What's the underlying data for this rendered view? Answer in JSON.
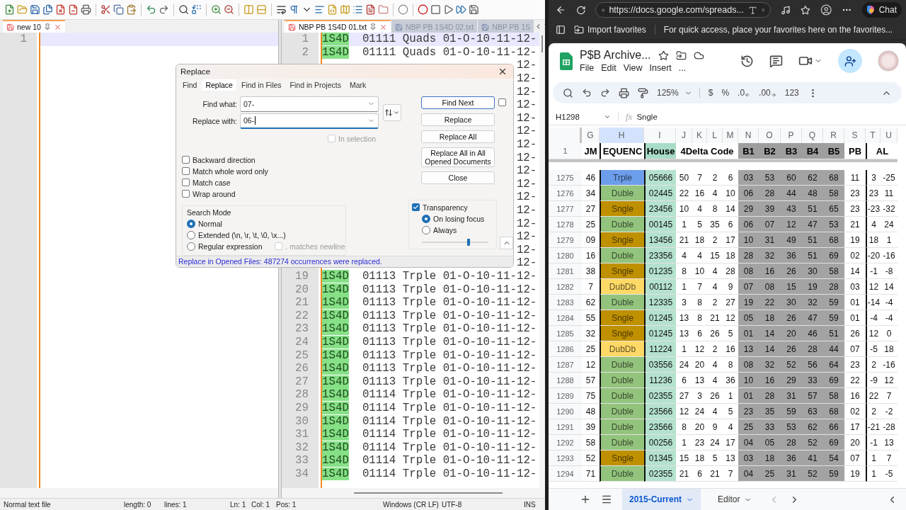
{
  "notepad": {
    "left_pane": {
      "tabs": [
        {
          "label": "new 10",
          "selected": true
        }
      ],
      "lines": [
        {
          "kind": "empty",
          "number": "1",
          "current": true
        }
      ]
    },
    "right_pane": {
      "tabs": [
        {
          "label": "NBP PB 1S4D 01.txt",
          "selected": true
        },
        {
          "label": "NBP PB 1S4D 02.txt",
          "selected": false
        },
        {
          "label": "NBP PB 1S",
          "selected": false
        }
      ],
      "lines": [
        {
          "kind": "full",
          "number": "1",
          "tag": "1S4D",
          "text": "01111 Quads 01-O-10-11-12-",
          "current": true
        },
        {
          "kind": "full",
          "number": "2",
          "tag": "1S4D",
          "text": "01111 Quads 01-O-10-11-12-",
          "current": false
        },
        {
          "kind": "tail",
          "text": "12-"
        },
        {
          "kind": "tail",
          "text": "12-"
        },
        {
          "kind": "tail",
          "text": "12-"
        },
        {
          "kind": "tail",
          "text": "12-"
        },
        {
          "kind": "tail",
          "text": "12-"
        },
        {
          "kind": "tail",
          "text": "12-"
        },
        {
          "kind": "tail",
          "text": "12-"
        },
        {
          "kind": "tail",
          "text": "12-"
        },
        {
          "kind": "tail",
          "text": "12-"
        },
        {
          "kind": "tail",
          "text": "12-"
        },
        {
          "kind": "tail",
          "text": "12-"
        },
        {
          "kind": "tail",
          "text": "12-"
        },
        {
          "kind": "tail",
          "text": "12-"
        },
        {
          "kind": "tail",
          "text": "12-"
        },
        {
          "kind": "tail",
          "text": "12-"
        },
        {
          "kind": "tail",
          "text": "12-"
        },
        {
          "kind": "full",
          "number": "19",
          "tag": "1S4D",
          "text": "01113 Trple 01-O-10-11-12-",
          "current": false
        },
        {
          "kind": "full",
          "number": "20",
          "tag": "1S4D",
          "text": "01113 Trple 01-O-10-11-12-",
          "current": false
        },
        {
          "kind": "full",
          "number": "21",
          "tag": "1S4D",
          "text": "01113 Trple 01-O-10-11-12-",
          "current": false
        },
        {
          "kind": "full",
          "number": "22",
          "tag": "1S4D",
          "text": "01113 Trple 01-O-10-11-12-",
          "current": false
        },
        {
          "kind": "full",
          "number": "23",
          "tag": "1S4D",
          "text": "01113 Trple 01-O-10-11-12-",
          "current": false
        },
        {
          "kind": "full",
          "number": "24",
          "tag": "1S4D",
          "text": "01113 Trple 01-O-10-11-12-",
          "current": false
        },
        {
          "kind": "full",
          "number": "25",
          "tag": "1S4D",
          "text": "01113 Trple 01-O-10-11-12-",
          "current": false
        },
        {
          "kind": "full",
          "number": "26",
          "tag": "1S4D",
          "text": "01113 Trple 01-O-10-11-12-",
          "current": false
        },
        {
          "kind": "full",
          "number": "27",
          "tag": "1S4D",
          "text": "01113 Trple 01-O-10-11-12-",
          "current": false
        },
        {
          "kind": "full",
          "number": "28",
          "tag": "1S4D",
          "text": "01114 Trple 01-O-10-11-12-",
          "current": false
        },
        {
          "kind": "full",
          "number": "29",
          "tag": "1S4D",
          "text": "01114 Trple 01-O-10-11-12-",
          "current": false
        },
        {
          "kind": "full",
          "number": "30",
          "tag": "1S4D",
          "text": "01114 Trple 01-O-10-11-12-",
          "current": false
        },
        {
          "kind": "full",
          "number": "31",
          "tag": "1S4D",
          "text": "01114 Trple 01-O-10-11-12-",
          "current": false
        },
        {
          "kind": "full",
          "number": "32",
          "tag": "1S4D",
          "text": "01114 Trple 01-O-10-11-12-",
          "current": false
        },
        {
          "kind": "full",
          "number": "33",
          "tag": "1S4D",
          "text": "01114 Trple 01-O-10-11-12-",
          "current": false
        },
        {
          "kind": "full",
          "number": "34",
          "tag": "1S4D",
          "text": "01114 Trple 01-O-10-11-12-",
          "current": false
        }
      ]
    },
    "status_bar": [
      "Normal text file",
      "length: 0",
      "lines: 1",
      "Ln: 1",
      "Col: 1",
      "Pos: 1",
      "Windows (CR LF)",
      "UTF-8",
      "INS"
    ]
  },
  "replace_dialog": {
    "title": "Replace",
    "tabs": [
      {
        "label": "Find",
        "selected": false
      },
      {
        "label": "Replace",
        "selected": true
      },
      {
        "label": "Find in Files",
        "selected": false
      },
      {
        "label": "Find in Projects",
        "selected": false
      },
      {
        "label": "Mark",
        "selected": false
      }
    ],
    "fields": [
      {
        "label": "Find what:",
        "value": "07-",
        "focused": false
      },
      {
        "label": "Replace with:",
        "value": "06-",
        "focused": true
      }
    ],
    "in_selection": {
      "label": "In selection",
      "checked": false,
      "disabled": true
    },
    "options": [
      {
        "label": "Backward direction",
        "checked": false
      },
      {
        "label": "Match whole word only",
        "checked": false
      },
      {
        "label": "Match case",
        "checked": false
      },
      {
        "label": "Wrap around",
        "checked": false
      }
    ],
    "search_mode": {
      "title": "Search Mode",
      "modes": [
        {
          "label": "Normal",
          "selected": true
        },
        {
          "label": "Extended (\\n, \\r, \\t, \\0, \\x...)",
          "selected": false
        },
        {
          "label": "Regular expression",
          "selected": false
        }
      ],
      "dot_newline": {
        "label": ". matches newline",
        "checked": false,
        "disabled": true
      }
    },
    "buttons": [
      {
        "label": "Find Next",
        "default": true
      },
      {
        "label": "Replace",
        "default": false
      },
      {
        "label": "Replace All",
        "default": false
      },
      {
        "label": "Replace All in All Opened Documents",
        "default": false
      },
      {
        "label": "Close",
        "default": false
      }
    ],
    "find_next_option": {
      "checked": false
    },
    "transparency": {
      "label": "Transparency",
      "checked": true,
      "modes": [
        {
          "label": "On losing focus",
          "selected": true
        },
        {
          "label": "Always",
          "selected": false
        }
      ],
      "level": 0.7
    },
    "status": "Replace in Opened Files: 487274 occurrences were replaced."
  },
  "browser": {
    "address": "https://docs.google.com/spreads...",
    "chat_button": "Chat",
    "favorites_bar": {
      "import": "Import favorites",
      "hint": "For quick access, place your favorites here on the favorites..."
    },
    "sheet": {
      "title": "P$B Archive...",
      "menu": [
        "File",
        "Edit",
        "View",
        "Insert",
        "..."
      ],
      "toolbar": {
        "zoom": "125%",
        "formats": [
          {
            "label": "$",
            "kind": "text"
          },
          {
            "label": "%",
            "kind": "text"
          },
          {
            "label": ".0",
            "kind": "decrease"
          },
          {
            "label": ".00",
            "kind": "increase"
          },
          {
            "label": "123",
            "kind": "text"
          }
        ]
      },
      "name_box": "H1298",
      "fx_label": "fx",
      "formula": "Sngle",
      "columns": [
        {
          "label": "G",
          "selected": false
        },
        {
          "label": "H",
          "selected": true
        },
        {
          "label": "I",
          "selected": false
        },
        {
          "label": "J",
          "selected": false
        },
        {
          "label": "K",
          "selected": false
        },
        {
          "label": "L",
          "selected": false
        },
        {
          "label": "M",
          "selected": false
        },
        {
          "label": "N",
          "selected": false
        },
        {
          "label": "O",
          "selected": false
        },
        {
          "label": "P",
          "selected": false
        },
        {
          "label": "Q",
          "selected": false
        },
        {
          "label": "R",
          "selected": false
        },
        {
          "label": "S",
          "selected": false
        },
        {
          "label": "T",
          "selected": false
        },
        {
          "label": "U",
          "selected": false
        }
      ],
      "header_row": {
        "number": "1",
        "cells": [
          "JM",
          "EQUENC",
          "House",
          "4Delta Code",
          "B1",
          "B2",
          "B3",
          "B4",
          "B5",
          "PB",
          "AL"
        ]
      },
      "rows": [
        {
          "number": "1275",
          "color": "#6d9eeb",
          "cells": [
            "46",
            "Trple",
            "05666",
            "50",
            "7",
            "2",
            "6",
            "03",
            "53",
            "60",
            "62",
            "68",
            "11",
            "3",
            "-25"
          ]
        },
        {
          "number": "1276",
          "color": "#93c47d",
          "cells": [
            "34",
            "Duble",
            "02445",
            "22",
            "16",
            "4",
            "10",
            "06",
            "28",
            "44",
            "48",
            "58",
            "23",
            "23",
            "11"
          ]
        },
        {
          "number": "1277",
          "color": "#bf9000",
          "cells": [
            "27",
            "Sngle",
            "23456",
            "10",
            "4",
            "8",
            "14",
            "29",
            "39",
            "43",
            "51",
            "65",
            "23",
            "-23",
            "-32"
          ]
        },
        {
          "number": "1278",
          "color": "#93c47d",
          "cells": [
            "25",
            "Duble",
            "00145",
            "1",
            "5",
            "35",
            "6",
            "06",
            "07",
            "12",
            "47",
            "53",
            "21",
            "4",
            "24"
          ]
        },
        {
          "number": "1279",
          "color": "#bf9000",
          "cells": [
            "09",
            "Sngle",
            "13456",
            "21",
            "18",
            "2",
            "17",
            "10",
            "31",
            "49",
            "51",
            "68",
            "19",
            "18",
            "1"
          ]
        },
        {
          "number": "1280",
          "color": "#93c47d",
          "cells": [
            "16",
            "Duble",
            "23356",
            "4",
            "4",
            "15",
            "18",
            "28",
            "32",
            "36",
            "51",
            "69",
            "02",
            "-20",
            "-16"
          ]
        },
        {
          "number": "1281",
          "color": "#bf9000",
          "cells": [
            "38",
            "Sngle",
            "01235",
            "8",
            "10",
            "4",
            "28",
            "08",
            "16",
            "26",
            "30",
            "58",
            "14",
            "-1",
            "-8"
          ]
        },
        {
          "number": "1282",
          "color": "#ffd966",
          "cells": [
            "7",
            "DubDb",
            "00112",
            "1",
            "7",
            "4",
            "9",
            "07",
            "08",
            "15",
            "19",
            "28",
            "03",
            "12",
            "14"
          ]
        },
        {
          "number": "1283",
          "color": "#93c47d",
          "cells": [
            "62",
            "Duble",
            "12335",
            "3",
            "8",
            "2",
            "27",
            "19",
            "22",
            "30",
            "32",
            "59",
            "01",
            "-14",
            "-4"
          ]
        },
        {
          "number": "1284",
          "color": "#bf9000",
          "cells": [
            "55",
            "Sngle",
            "01245",
            "13",
            "8",
            "21",
            "12",
            "05",
            "18",
            "26",
            "47",
            "59",
            "01",
            "-4",
            "-4"
          ]
        },
        {
          "number": "1285",
          "color": "#bf9000",
          "cells": [
            "32",
            "Sngle",
            "01245",
            "13",
            "6",
            "26",
            "5",
            "01",
            "14",
            "20",
            "46",
            "51",
            "26",
            "12",
            "0"
          ]
        },
        {
          "number": "1286",
          "color": "#ffd966",
          "cells": [
            "25",
            "DubDb",
            "11224",
            "1",
            "12",
            "2",
            "16",
            "13",
            "14",
            "26",
            "28",
            "44",
            "07",
            "-5",
            "18"
          ]
        },
        {
          "number": "1287",
          "color": "#93c47d",
          "cells": [
            "12",
            "Duble",
            "03556",
            "24",
            "20",
            "4",
            "8",
            "08",
            "32",
            "52",
            "56",
            "64",
            "23",
            "2",
            "-16"
          ]
        },
        {
          "number": "1288",
          "color": "#93c47d",
          "cells": [
            "57",
            "Duble",
            "11236",
            "6",
            "13",
            "4",
            "36",
            "10",
            "16",
            "29",
            "33",
            "69",
            "22",
            "-9",
            "12"
          ]
        },
        {
          "number": "1289",
          "color": "#93c47d",
          "cells": [
            "75",
            "Duble",
            "02355",
            "27",
            "3",
            "26",
            "1",
            "01",
            "28",
            "31",
            "57",
            "58",
            "16",
            "22",
            "7"
          ]
        },
        {
          "number": "1290",
          "color": "#93c47d",
          "cells": [
            "48",
            "Duble",
            "23566",
            "12",
            "24",
            "4",
            "5",
            "23",
            "35",
            "59",
            "63",
            "68",
            "02",
            "2",
            "-2"
          ]
        },
        {
          "number": "1291",
          "color": "#93c47d",
          "cells": [
            "39",
            "Duble",
            "23566",
            "8",
            "20",
            "9",
            "4",
            "25",
            "33",
            "53",
            "62",
            "66",
            "17",
            "-21",
            "-28"
          ]
        },
        {
          "number": "1292",
          "color": "#93c47d",
          "cells": [
            "58",
            "Duble",
            "00256",
            "1",
            "23",
            "24",
            "17",
            "04",
            "05",
            "28",
            "52",
            "69",
            "20",
            "-1",
            "13"
          ]
        },
        {
          "number": "1293",
          "color": "#bf9000",
          "cells": [
            "52",
            "Sngle",
            "01345",
            "15",
            "18",
            "5",
            "13",
            "03",
            "18",
            "36",
            "41",
            "54",
            "07",
            "1",
            "7"
          ]
        },
        {
          "number": "1294",
          "color": "#93c47d",
          "cells": [
            "71",
            "Duble",
            "02355",
            "21",
            "6",
            "21",
            "7",
            "04",
            "25",
            "31",
            "52",
            "59",
            "19",
            "1",
            "-5"
          ]
        }
      ],
      "sheet_tabs": [
        {
          "label": "2015-Current",
          "selected": true
        },
        {
          "label": "Editor",
          "selected": false
        }
      ]
    }
  }
}
